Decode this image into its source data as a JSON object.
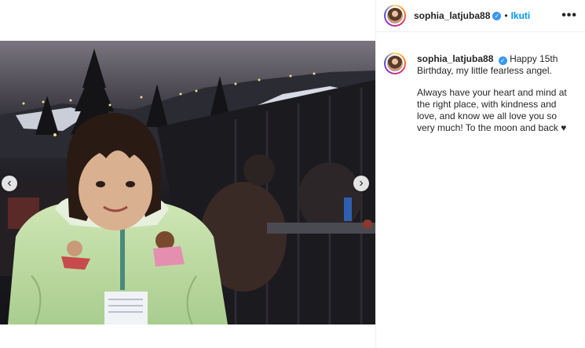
{
  "post": {
    "username": "sophia_latjuba88",
    "follow_label": "Ikuti",
    "separator": "•",
    "more_label": "•••",
    "verified_glyph": "✓",
    "caption_lines": [
      "Happy 15th Birthday, my little fearless angel.",
      "Always have your heart and mind at the right place, with kindness and love, and know we all love you so very much! To the moon and back ♥"
    ]
  },
  "media": {
    "prev_label": "‹",
    "next_label": "›"
  },
  "icons": {
    "verified": "verified-badge-icon",
    "more": "more-options-icon",
    "prev": "chevron-left-icon",
    "next": "chevron-right-icon"
  },
  "colors": {
    "follow": "#0095f6",
    "verified": "#3897f0",
    "text": "#262626"
  }
}
